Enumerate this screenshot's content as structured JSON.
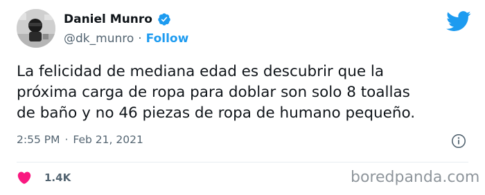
{
  "author": {
    "name": "Daniel Munro",
    "handle": "@dk_munro",
    "separator": "·",
    "follow_label": "Follow"
  },
  "tweet": {
    "lines": [
      "La felicidad de mediana edad es descubrir que la",
      "próxima carga de ropa para doblar son solo 8 toallas",
      "de baño y no 46 piezas de ropa de humano pequeño."
    ],
    "time": "2:55 PM",
    "meta_separator": "·",
    "date": "Feb 21, 2021"
  },
  "engagement": {
    "likes": "1.4K"
  },
  "watermark": "boredpanda.com",
  "icons": {
    "brand": "twitter-bird-icon",
    "verified": "verified-badge-icon",
    "info": "info-icon",
    "like": "heart-icon"
  },
  "colors": {
    "accent": "#1d9bf0",
    "heart": "#f91880",
    "text": "#0f1419",
    "muted": "#536471"
  }
}
